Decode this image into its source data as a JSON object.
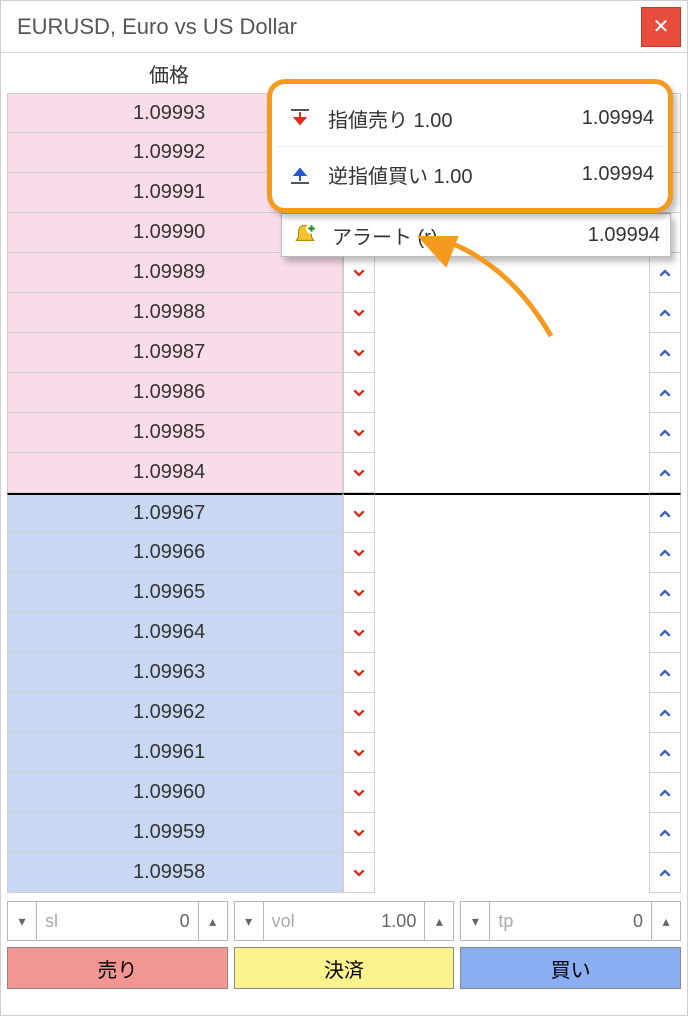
{
  "window": {
    "title": "EURUSD, Euro vs US Dollar"
  },
  "header": {
    "price_label": "価格"
  },
  "prices": {
    "ask": [
      "1.09993",
      "1.09992",
      "1.09991",
      "1.09990",
      "1.09989",
      "1.09988",
      "1.09987",
      "1.09986",
      "1.09985",
      "1.09984"
    ],
    "bid": [
      "1.09967",
      "1.09966",
      "1.09965",
      "1.09964",
      "1.09963",
      "1.09962",
      "1.09961",
      "1.09960",
      "1.09959",
      "1.09958"
    ]
  },
  "popup": {
    "sell_limit": {
      "label": "指値売り 1.00",
      "value": "1.09994"
    },
    "buy_stop": {
      "label": "逆指値買い 1.00",
      "value": "1.09994"
    },
    "alert": {
      "label": "アラート (r)",
      "value": "1.09994"
    }
  },
  "inputs": {
    "sl": {
      "label": "sl",
      "value": "0"
    },
    "vol": {
      "label": "vol",
      "value": "1.00"
    },
    "tp": {
      "label": "tp",
      "value": "0"
    }
  },
  "actions": {
    "sell": "売り",
    "close": "決済",
    "buy": "買い"
  },
  "glyphs": {
    "close": "✕",
    "tri_down": "▾",
    "tri_up": "▴"
  },
  "colors": {
    "highlight": "#f49b1f",
    "ask_bg": "#fadbea",
    "bid_bg": "#c8d7f2",
    "sell_btn": "#f29694",
    "close_btn": "#fbf38e",
    "buy_btn": "#8aaef2"
  }
}
